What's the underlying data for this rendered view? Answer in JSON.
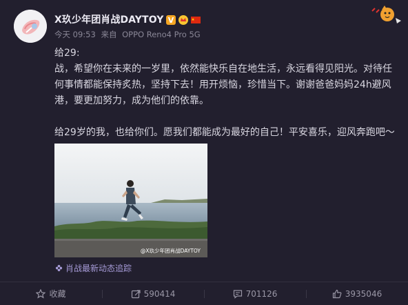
{
  "post": {
    "username": "X玖少年团肖战DAYTOY",
    "badges": [
      "verified-badge",
      "crown-badge",
      "china-flag-badge"
    ],
    "timestamp": "今天 09:53",
    "source_prefix": "来自",
    "source": "OPPO Reno4 Pro 5G",
    "text_lines": [
      "给29:",
      "战，希望你在未来的一岁里，依然能快乐自在地生活，永远看得见阳光。对待任",
      "何事情都能保持炙热，坚持下去！用开烦恼，珍惜当下。谢谢爸爸妈妈24h避风",
      "港，要更加努力，成为他们的依靠。",
      "",
      "给29岁的我，也给你们。愿我们都能成为最好的自己！平安喜乐，迎风奔跑吧～"
    ],
    "photo_watermark": "@X玖少年团肖战DAYTOY",
    "topic": "肖战最新动态追踪"
  },
  "actions": {
    "favorite_label": "收藏",
    "repost_count": "590414",
    "comment_count": "701126",
    "like_count": "3935046"
  },
  "colors": {
    "background": "#221f2e",
    "topic_purple": "#a59ad6",
    "muted_text": "#8a8797",
    "verified_orange": "#f5a623",
    "flag_red": "#de2910"
  }
}
